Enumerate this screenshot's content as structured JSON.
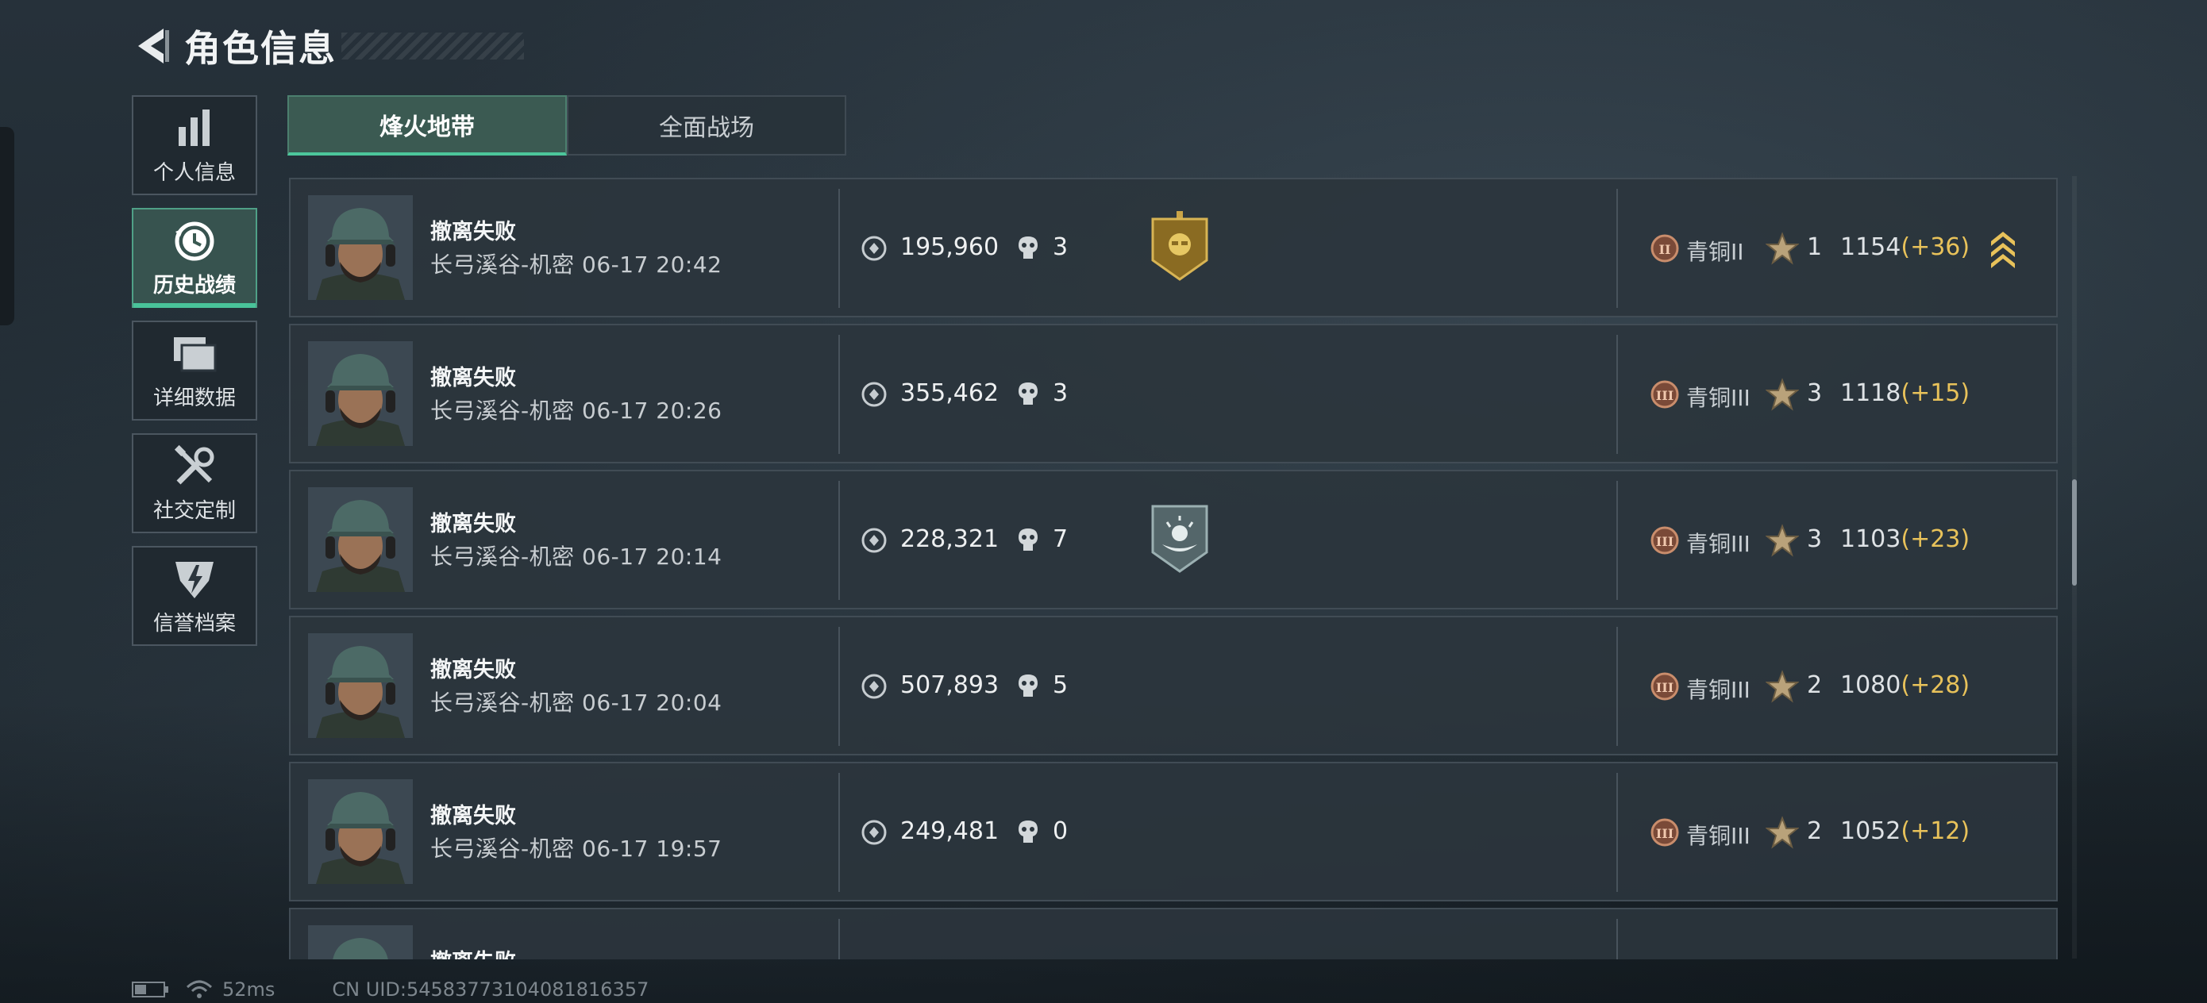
{
  "header": {
    "title": "角色信息"
  },
  "sidebar": {
    "items": [
      {
        "label": "个人信息",
        "icon": "bar-chart-icon"
      },
      {
        "label": "历史战绩",
        "icon": "clock-history-icon",
        "active": true
      },
      {
        "label": "详细数据",
        "icon": "folders-icon"
      },
      {
        "label": "社交定制",
        "icon": "tools-icon"
      },
      {
        "label": "信誉档案",
        "icon": "shield-bolt-icon"
      }
    ]
  },
  "tabs": [
    {
      "label": "烽火地带",
      "active": true
    },
    {
      "label": "全面战场",
      "active": false
    }
  ],
  "rows": [
    {
      "result": "撤离失败",
      "map": "长弓溪谷-机密",
      "time": "06-17 20:42",
      "value": "195,960",
      "kills": "3",
      "badge": "gold-skull-badge",
      "rank": "青铜II",
      "rank_icon": "II",
      "stars": "1",
      "score": "1154",
      "delta": "(+36)",
      "promo": "rank-up-chevrons-icon"
    },
    {
      "result": "撤离失败",
      "map": "长弓溪谷-机密",
      "time": "06-17 20:26",
      "value": "355,462",
      "kills": "3",
      "badge": "",
      "rank": "青铜III",
      "rank_icon": "III",
      "stars": "3",
      "score": "1118",
      "delta": "(+15)",
      "promo": ""
    },
    {
      "result": "撤离失败",
      "map": "长弓溪谷-机密",
      "time": "06-17 20:14",
      "value": "228,321",
      "kills": "7",
      "badge": "silver-medic-badge",
      "rank": "青铜III",
      "rank_icon": "III",
      "stars": "3",
      "score": "1103",
      "delta": "(+23)",
      "promo": ""
    },
    {
      "result": "撤离失败",
      "map": "长弓溪谷-机密",
      "time": "06-17 20:04",
      "value": "507,893",
      "kills": "5",
      "badge": "",
      "rank": "青铜III",
      "rank_icon": "III",
      "stars": "2",
      "score": "1080",
      "delta": "(+28)",
      "promo": ""
    },
    {
      "result": "撤离失败",
      "map": "长弓溪谷-机密",
      "time": "06-17 19:57",
      "value": "249,481",
      "kills": "0",
      "badge": "",
      "rank": "青铜III",
      "rank_icon": "III",
      "stars": "2",
      "score": "1052",
      "delta": "(+12)",
      "promo": ""
    },
    {
      "result": "撤离失败",
      "map": "",
      "time": "",
      "value": "",
      "kills": "",
      "badge": "",
      "rank": "",
      "rank_icon": "",
      "stars": "",
      "score": "",
      "delta": "",
      "promo": ""
    }
  ],
  "status": {
    "ping": "52ms",
    "uid": "CN UID:545837731040818163​57"
  },
  "colors": {
    "accent": "#49c39a",
    "delta": "#e8c25a",
    "badge_gold": "#c9a447",
    "rank_bronze": "#b87a5a"
  }
}
